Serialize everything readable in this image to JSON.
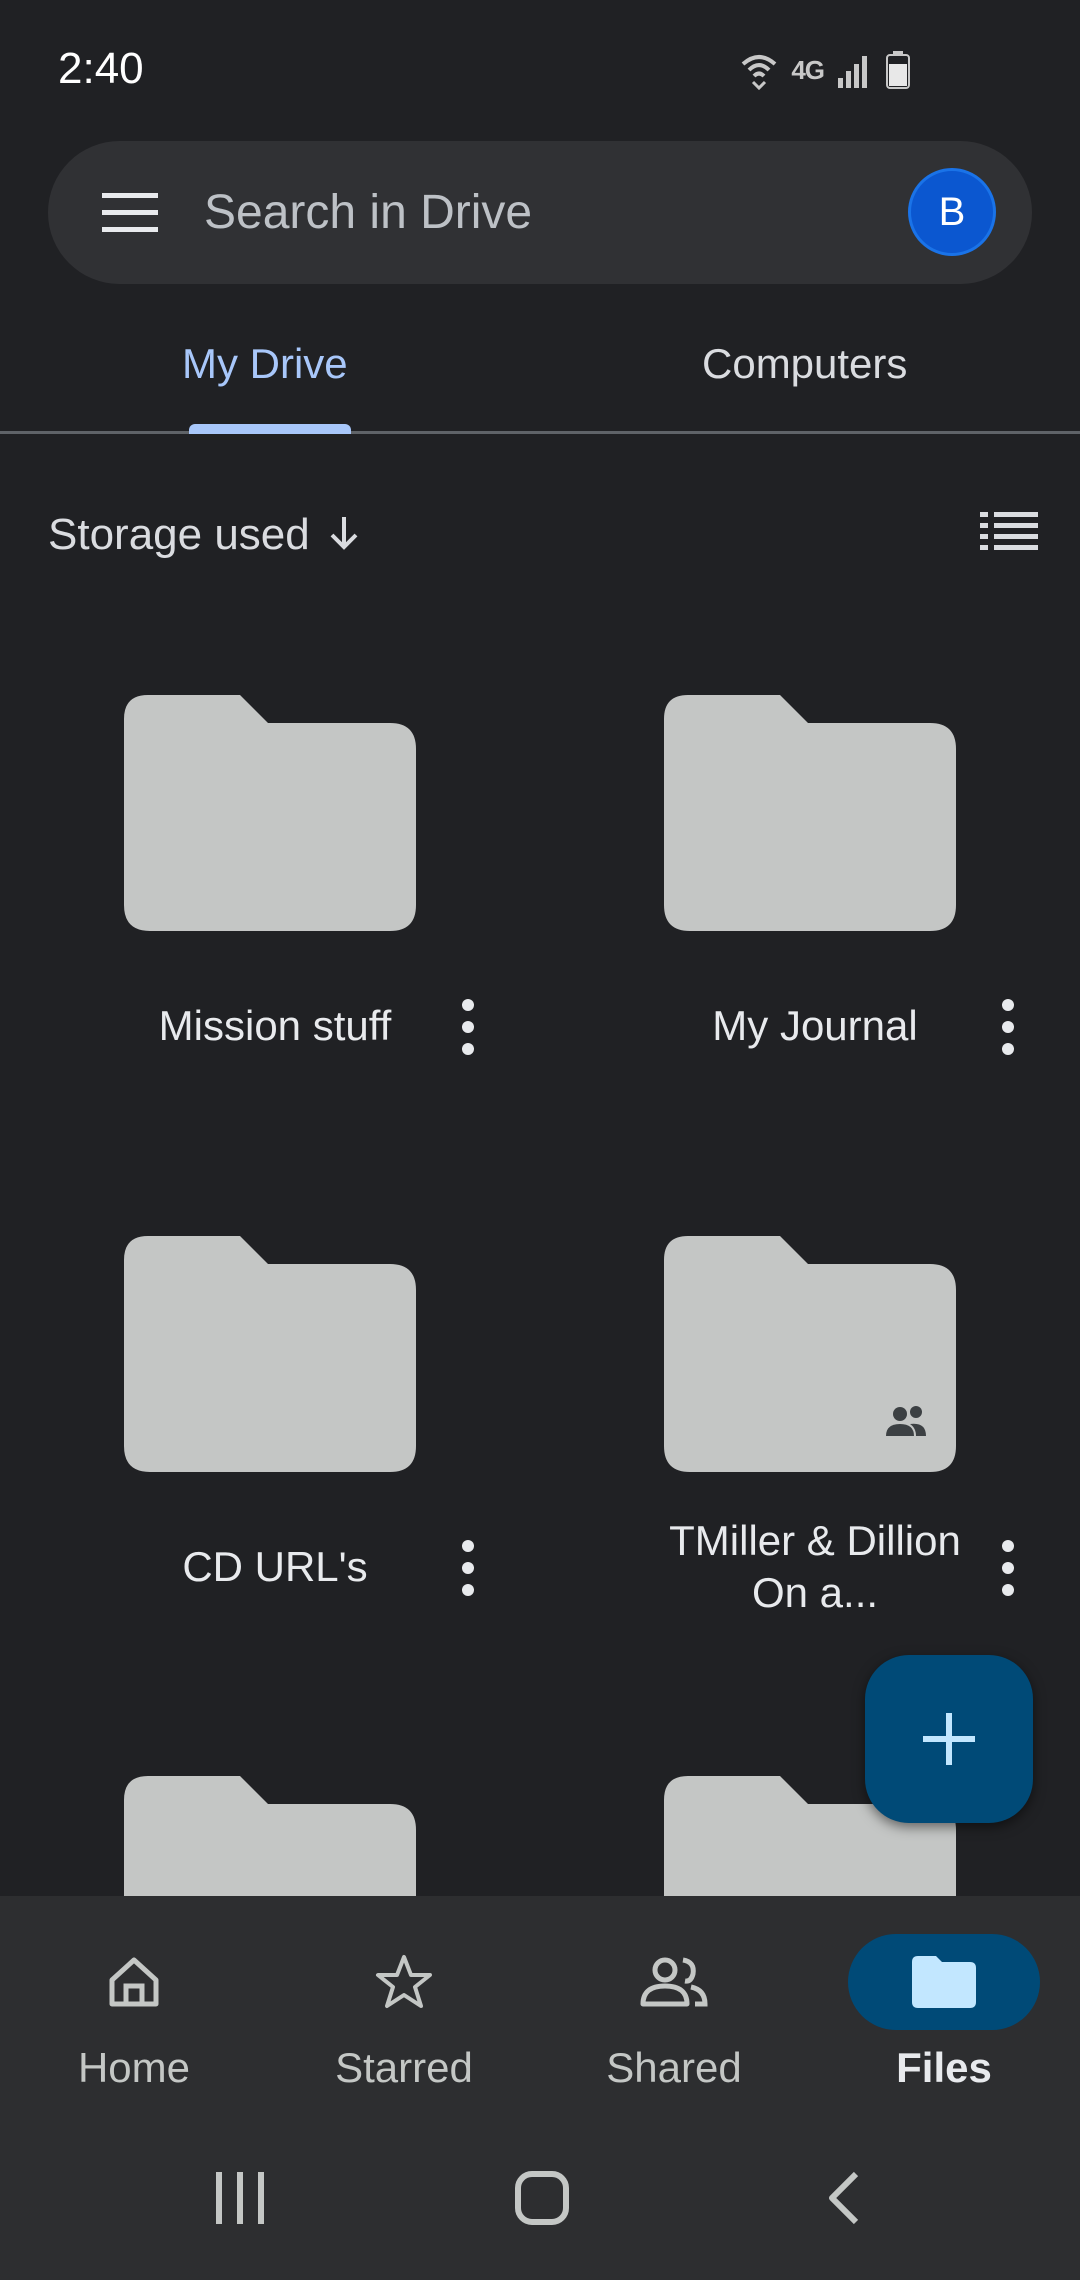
{
  "status_bar": {
    "time": "2:40",
    "network_label": "4G",
    "icons": [
      "wifi-icon",
      "network-4g-icon",
      "signal-icon",
      "battery-icon"
    ]
  },
  "search": {
    "placeholder": "Search in Drive",
    "avatar_initial": "B",
    "menu_icon": "hamburger-menu-icon"
  },
  "tabs": [
    {
      "label": "My Drive",
      "active": true
    },
    {
      "label": "Computers",
      "active": false
    }
  ],
  "sort": {
    "label": "Storage used",
    "direction_icon": "arrow-down-icon",
    "view_icon": "list-view-icon"
  },
  "folders": [
    {
      "name": "Mission stuff",
      "shared": false
    },
    {
      "name": "My Journal",
      "shared": false
    },
    {
      "name": "CD URL's",
      "shared": false
    },
    {
      "name": "TMiller & Dillion On a...",
      "shared": true
    },
    {
      "name": "",
      "shared": false
    },
    {
      "name": "",
      "shared": false
    }
  ],
  "fab": {
    "icon": "plus-icon"
  },
  "bottom_nav": [
    {
      "label": "Home",
      "icon": "home-icon",
      "active": false
    },
    {
      "label": "Starred",
      "icon": "star-icon",
      "active": false
    },
    {
      "label": "Shared",
      "icon": "shared-people-icon",
      "active": false
    },
    {
      "label": "Files",
      "icon": "folder-icon",
      "active": true
    }
  ],
  "colors": {
    "background": "#202124",
    "accent": "#a8c7fa",
    "fab": "#004a77",
    "folder": "#c4c6c5",
    "nav_bar": "#2d2e30"
  }
}
